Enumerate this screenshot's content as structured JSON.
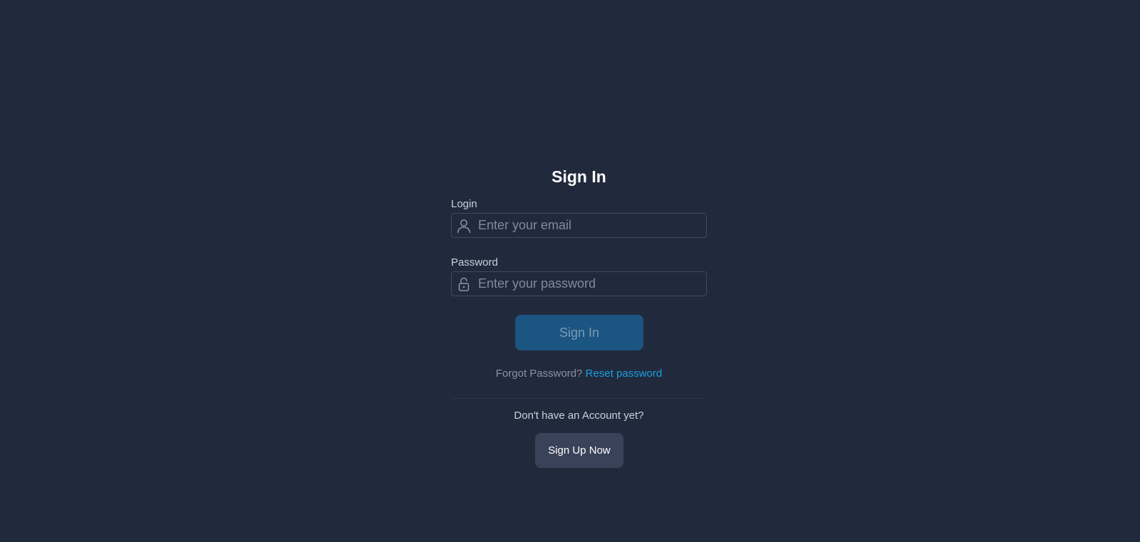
{
  "form": {
    "title": "Sign In",
    "login_label": "Login",
    "email_placeholder": "Enter your email",
    "email_value": "",
    "password_label": "Password",
    "password_placeholder": "Enter your password",
    "password_value": "",
    "signin_label": "Sign In",
    "forgot_text": "Forgot Password?",
    "reset_link": "Reset password",
    "no_account_text": "Don't have an Account yet?",
    "signup_label": "Sign Up Now"
  },
  "icons": {
    "email": "user-icon",
    "password": "lock-icon"
  },
  "colors": {
    "background": "#212a3c",
    "primary_button": "#1b5582",
    "secondary_button": "#384259",
    "link": "#1a9fe0"
  }
}
